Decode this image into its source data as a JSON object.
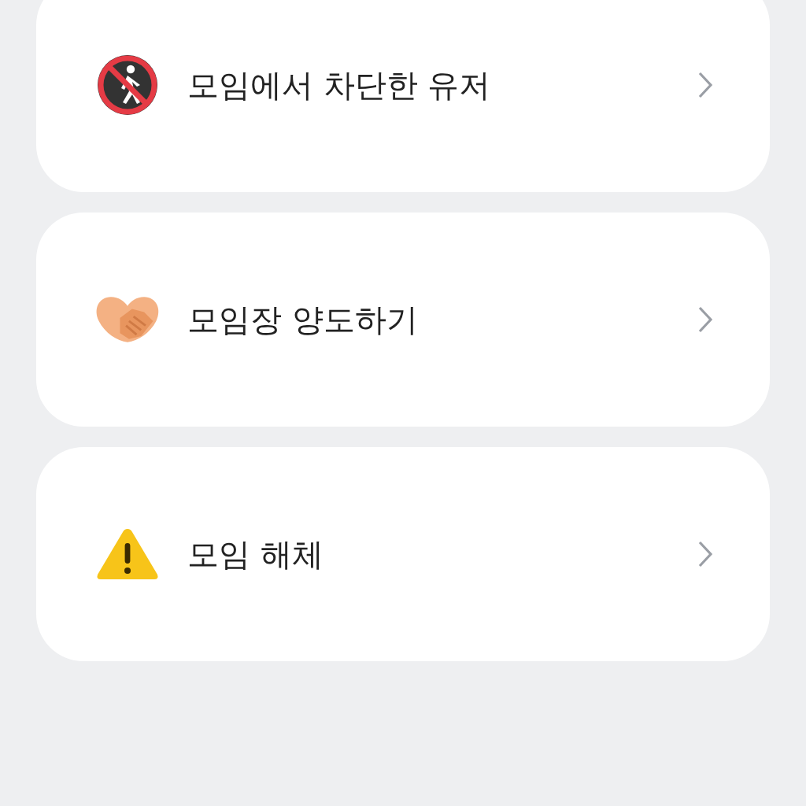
{
  "menu_items": [
    {
      "kind": "blocked",
      "label": "모임에서 차단한 유저"
    },
    {
      "kind": "handshake",
      "label": "모임장 양도하기"
    },
    {
      "kind": "warning",
      "label": "모임 해체"
    }
  ]
}
